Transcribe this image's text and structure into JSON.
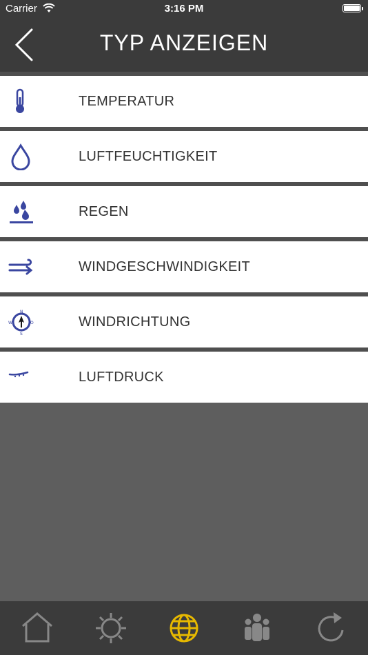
{
  "status_bar": {
    "carrier": "Carrier",
    "time": "3:16 PM"
  },
  "header": {
    "title": "TYP ANZEIGEN"
  },
  "list": {
    "items": [
      {
        "label": "TEMPERATUR",
        "icon": "thermometer-icon"
      },
      {
        "label": "LUFTFEUCHTIGKEIT",
        "icon": "drop-icon"
      },
      {
        "label": "REGEN",
        "icon": "rain-icon"
      },
      {
        "label": "WINDGESCHWINDIGKEIT",
        "icon": "wind-icon"
      },
      {
        "label": "WINDRICHTUNG",
        "icon": "compass-icon"
      },
      {
        "label": "LUFTDRUCK",
        "icon": "pressure-icon"
      }
    ]
  },
  "tabbar": {
    "items": [
      {
        "icon": "home-icon",
        "selected": false
      },
      {
        "icon": "gear-icon",
        "selected": false
      },
      {
        "icon": "globe-icon",
        "selected": true
      },
      {
        "icon": "people-icon",
        "selected": false
      },
      {
        "icon": "refresh-icon",
        "selected": false
      }
    ]
  },
  "colors": {
    "accent": "#e6b800",
    "icon_blue": "#3a46a0",
    "header_bg": "#3b3b3b"
  }
}
